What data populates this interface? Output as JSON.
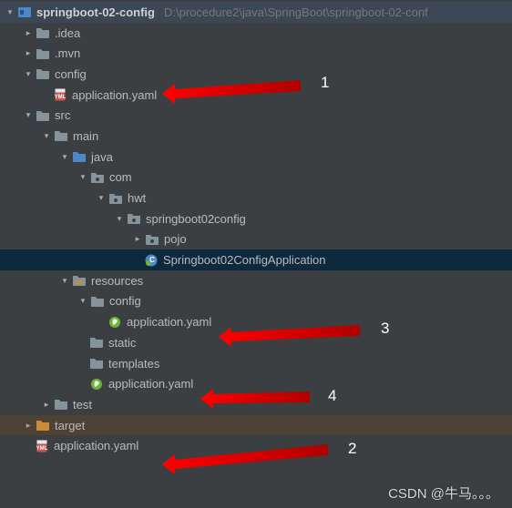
{
  "project": {
    "name": "springboot-02-config",
    "path": "D:\\procedure2\\java\\SpringBoot\\springboot-02-conf"
  },
  "nodes": {
    "idea": ".idea",
    "mvn": ".mvn",
    "config": "config",
    "appyaml1": "application.yaml",
    "src": "src",
    "main": "main",
    "java": "java",
    "com": "com",
    "hwt": "hwt",
    "pkg": "springboot02config",
    "pojo": "pojo",
    "appclass": "Springboot02ConfigApplication",
    "resources": "resources",
    "resconfig": "config",
    "appyaml3": "application.yaml",
    "static": "static",
    "templates": "templates",
    "appyaml4": "application.yaml",
    "test": "test",
    "target": "target",
    "appyaml2": "application.yaml"
  },
  "annotations": {
    "a1": "1",
    "a2": "2",
    "a3": "3",
    "a4": "4"
  },
  "watermark": "CSDN @牛马。。。"
}
